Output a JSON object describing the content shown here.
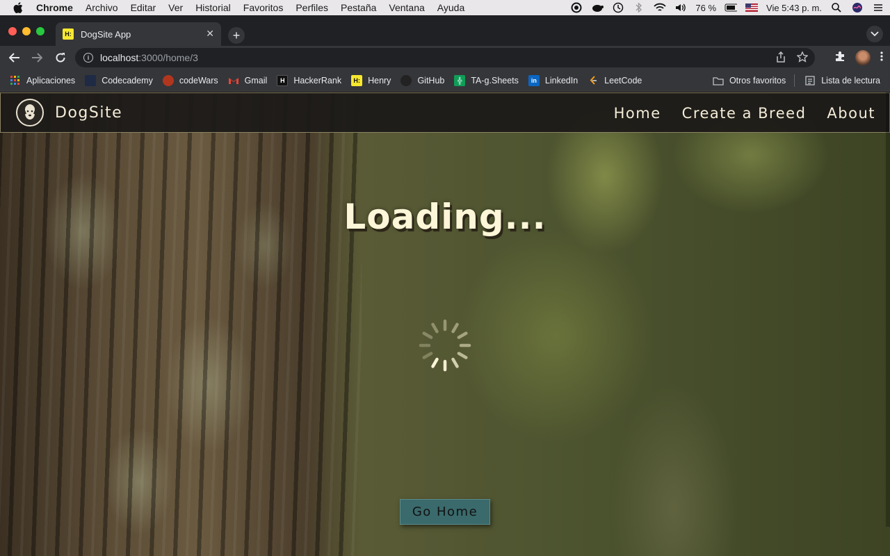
{
  "menubar": {
    "app": "Chrome",
    "items": [
      "Archivo",
      "Editar",
      "Ver",
      "Historial",
      "Favoritos",
      "Perfiles",
      "Pestaña",
      "Ventana",
      "Ayuda"
    ],
    "battery": "76 %",
    "clock": "Vie 5:43 p. m."
  },
  "browser": {
    "tab_title": "DogSite App",
    "url_host": "localhost",
    "url_path": ":3000/home/3"
  },
  "bookmarks": {
    "items": [
      {
        "label": "Aplicaciones",
        "icon": "apps-grid-icon",
        "color": "#e8453c"
      },
      {
        "label": "Codecademy",
        "icon": "codecademy-icon",
        "color": "#1f2a44"
      },
      {
        "label": "codeWars",
        "icon": "codewars-icon",
        "color": "#b1361e"
      },
      {
        "label": "Gmail",
        "icon": "gmail-icon",
        "color": "#ea4335"
      },
      {
        "label": "HackerRank",
        "icon": "hackerrank-icon",
        "color": "#111111"
      },
      {
        "label": "Henry",
        "icon": "henry-icon",
        "color": "#f7e82f"
      },
      {
        "label": "GitHub",
        "icon": "github-icon",
        "color": "#222222"
      },
      {
        "label": "TA-g.Sheets",
        "icon": "sheets-icon",
        "color": "#0f9d58"
      },
      {
        "label": "LinkedIn",
        "icon": "linkedin-icon",
        "color": "#0a66c2"
      },
      {
        "label": "LeetCode",
        "icon": "leetcode-icon",
        "color": "#f89f1b"
      }
    ],
    "other_favorites": "Otros favoritos",
    "reading_list": "Lista de lectura"
  },
  "site": {
    "brand": "DogSite",
    "nav": [
      "Home",
      "Create a Breed",
      "About"
    ],
    "loading_text": "Loading...",
    "button_label": "Go Home"
  }
}
